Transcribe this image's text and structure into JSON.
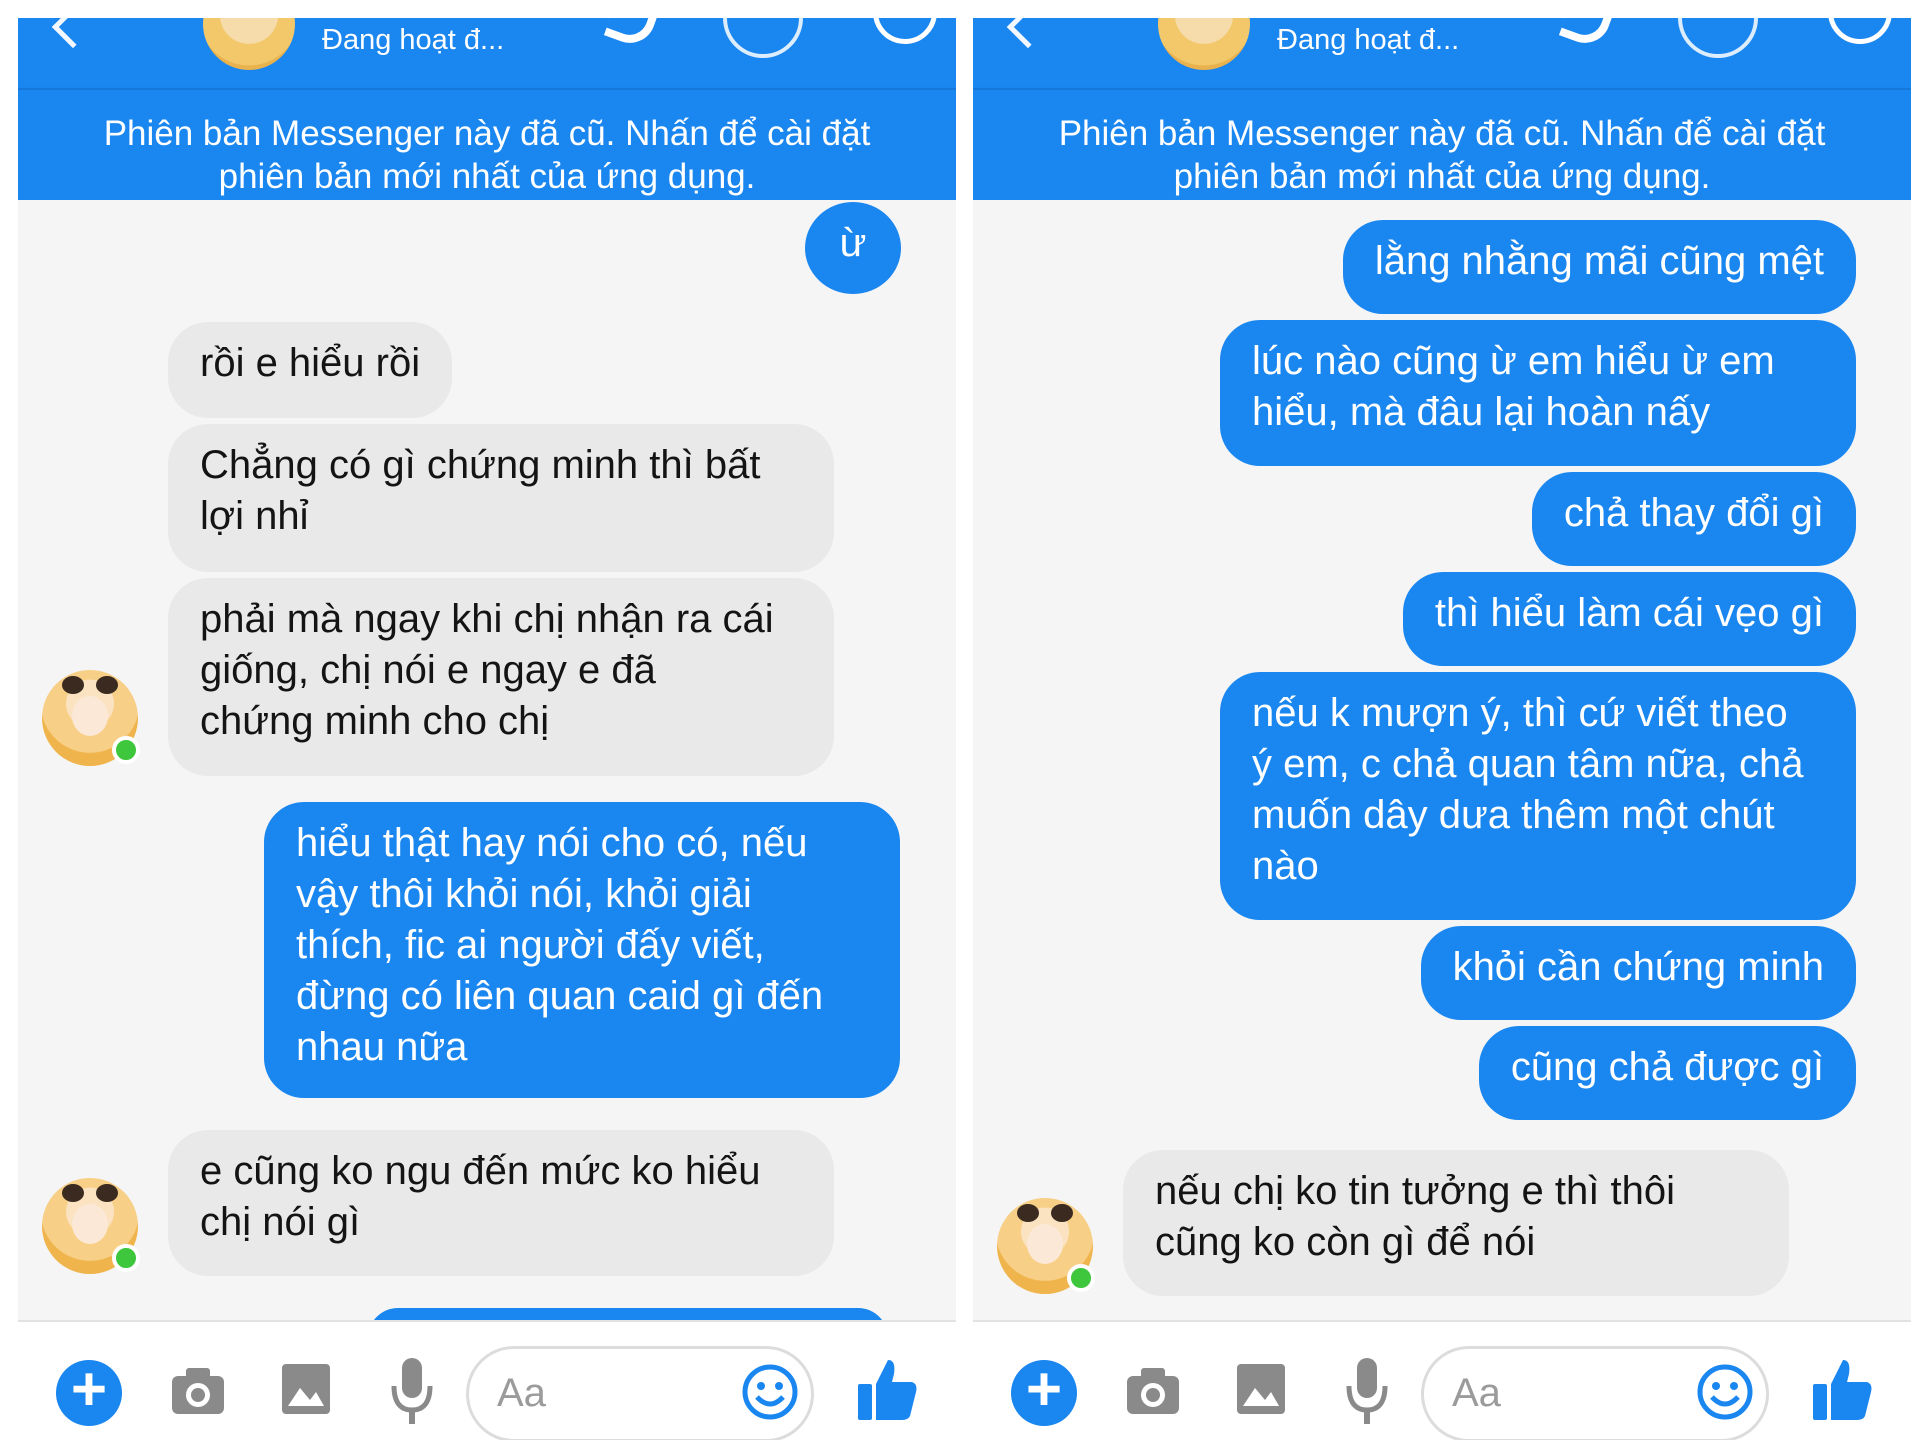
{
  "panels": [
    {
      "header": {
        "status": "Đang hoạt đ..."
      },
      "banner": "Phiên bản Messenger này đã cũ. Nhấn để cài đặt\nphiên bản mới nhất của ứng dụng.",
      "messages": [
        {
          "dir": "out",
          "text": "ừ"
        },
        {
          "dir": "in",
          "text": "rồi e hiểu rồi"
        },
        {
          "dir": "in",
          "text": "Chẳng có gì chứng minh thì bất\nlợi nhỉ"
        },
        {
          "dir": "in",
          "text": "phải mà ngay khi chị nhận ra cái\ngiống, chị nói e ngay e đã\nchứng minh cho chị"
        },
        {
          "dir": "out",
          "text": "hiểu thật hay nói cho có, nếu\nvậy thôi khỏi nói, khỏi giải\nthích, fic ai người đấy viết,\nđừng có liên quan caid gì đến\nnhau nữa"
        },
        {
          "dir": "in",
          "text": "e cũng ko ngu đến mức ko hiểu\nchị nói gì"
        }
      ],
      "composer": {
        "placeholder": "Aa"
      }
    },
    {
      "header": {
        "status": "Đang hoạt đ..."
      },
      "banner": "Phiên bản Messenger này đã cũ. Nhấn để cài đặt\nphiên bản mới nhất của ứng dụng.",
      "messages": [
        {
          "dir": "out",
          "text": "lằng nhằng mãi cũng mệt"
        },
        {
          "dir": "out",
          "text": "lúc nào cũng ừ em hiểu ừ em\nhiểu, mà đâu lại hoàn nấy"
        },
        {
          "dir": "out",
          "text": "chả thay đổi gì"
        },
        {
          "dir": "out",
          "text": "thì hiểu làm cái vẹo gì"
        },
        {
          "dir": "out",
          "text": "nếu k mượn ý, thì cứ viết theo\ný em, c chả quan tâm nữa, chả\nmuốn dây dưa thêm một chút\nnào"
        },
        {
          "dir": "out",
          "text": "khỏi cần chứng minh"
        },
        {
          "dir": "out",
          "text": "cũng chả được gì"
        },
        {
          "dir": "in",
          "text": "nếu chị ko tin tưởng e thì thôi\ncũng ko còn gì để nói"
        }
      ],
      "composer": {
        "placeholder": "Aa"
      }
    }
  ],
  "colors": {
    "messenger_blue": "#1a86f0",
    "incoming_bubble": "#e9e9e9",
    "online_green": "#3ec63c"
  },
  "icons": [
    "back-arrow-icon",
    "phone-icon",
    "video-camera-icon",
    "info-icon",
    "plus-icon",
    "camera-icon",
    "gallery-icon",
    "microphone-icon",
    "emoji-icon",
    "thumbs-up-icon"
  ]
}
